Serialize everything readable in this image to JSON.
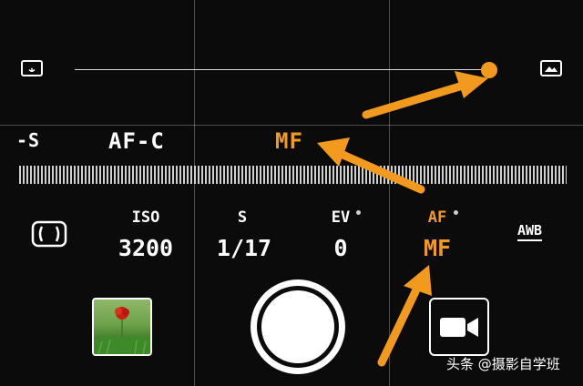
{
  "colors": {
    "accent": "#f29a1d",
    "foreground": "#ffffff",
    "background": "#0b0b0b"
  },
  "focus_slider": {
    "left_icon": "macro-flower-icon",
    "right_icon": "landscape-mountain-icon",
    "value": 0.99
  },
  "mode_row": {
    "partial_left": "-S",
    "af_mode": "AF-C",
    "selected_mode": "MF"
  },
  "settings": {
    "lens_icon": "lens-bracket-icon",
    "iso": {
      "label": "ISO",
      "value": "3200"
    },
    "shutter": {
      "label": "S",
      "value": "1/17"
    },
    "ev": {
      "label": "EV",
      "value": "0"
    },
    "focus": {
      "label": "AF",
      "value": "MF"
    },
    "white_balance": {
      "label": "AWB"
    }
  },
  "bottom": {
    "thumbnail_icon": "gallery-thumbnail-icon",
    "shutter_icon": "shutter-button-icon",
    "video_icon": "video-camera-icon"
  },
  "watermark": {
    "text": "头条 @摄影自学班"
  }
}
